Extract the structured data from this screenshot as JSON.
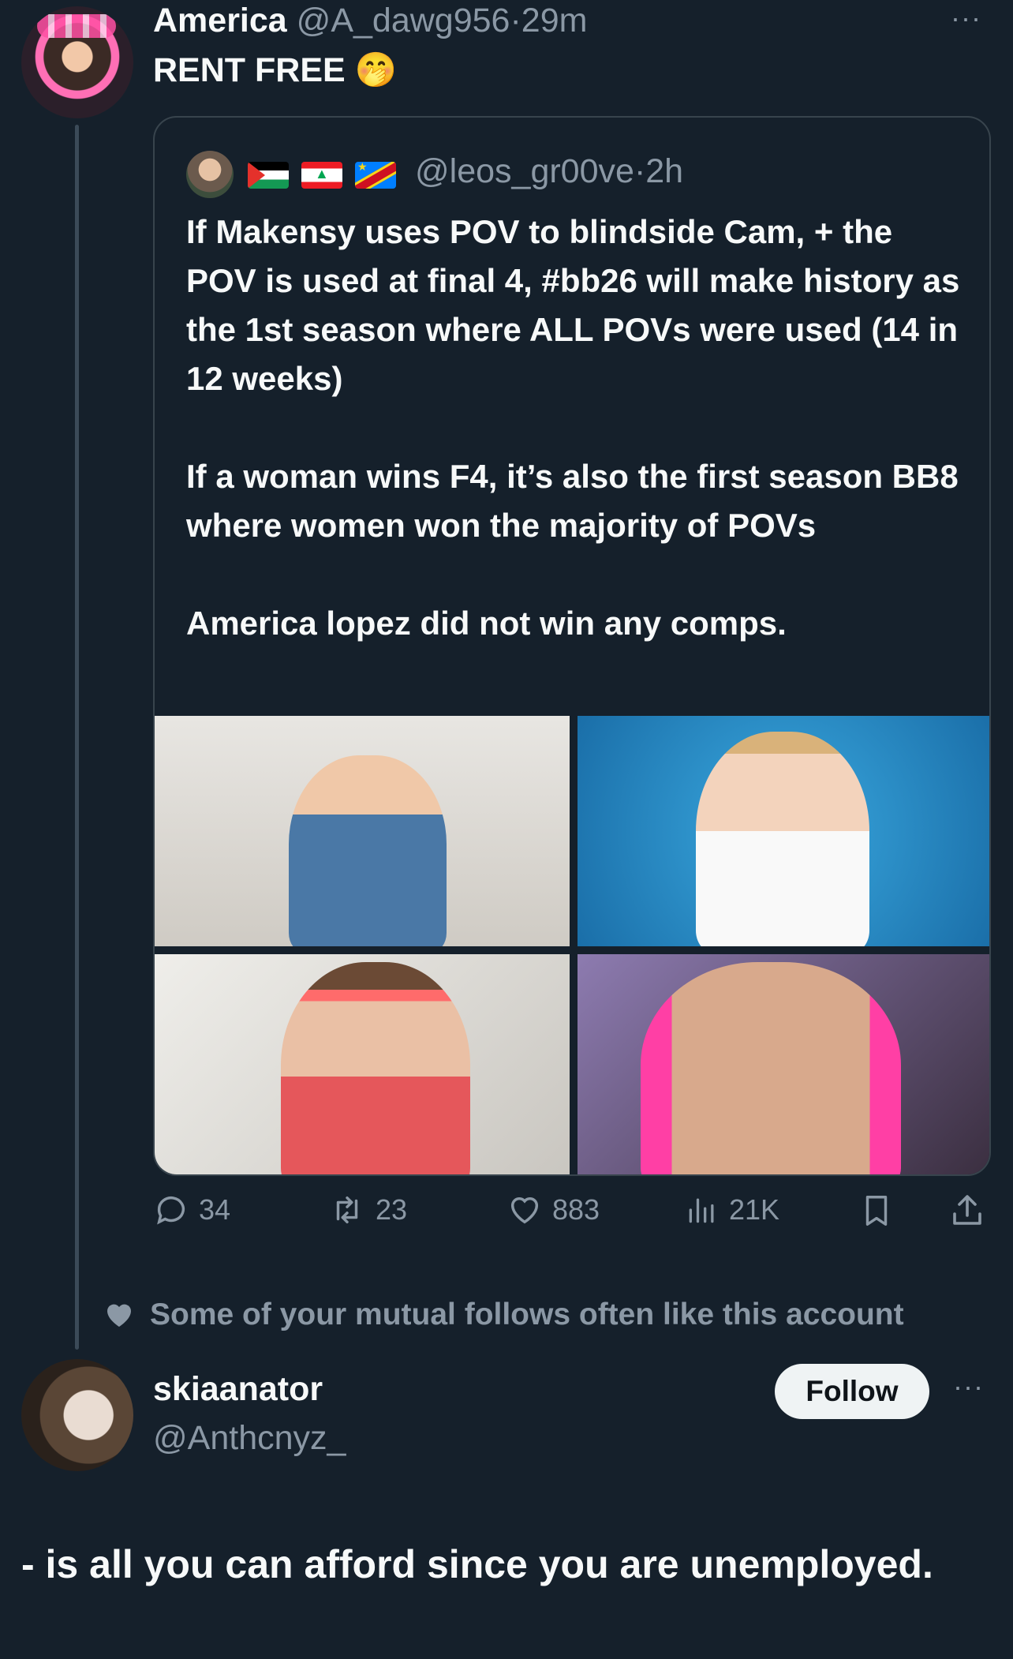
{
  "top_post": {
    "name": "America",
    "handle": "@A_dawg956",
    "dot": "·",
    "time": "29m",
    "text": "RENT FREE",
    "emoji": "🤭",
    "more": "···"
  },
  "quote": {
    "handle": "@leos_gr00ve",
    "dot": "·",
    "time": "2h",
    "flags": [
      "Palestine flag",
      "Lebanon flag",
      "DR Congo flag"
    ],
    "paragraph1": "If Makensy uses POV to blindside Cam, + the POV is used at final 4, #bb26 will make history as the 1st season where ALL POVs were used (14 in 12 weeks)",
    "paragraph2": "If a woman wins F4, it’s also the first season BB8 where women won the majority of POVs",
    "paragraph3": "America lopez did not win any comps."
  },
  "actions": {
    "replies": "34",
    "reposts": "23",
    "likes": "883",
    "views": "21K"
  },
  "social_proof": "Some of your mutual follows often like this account",
  "reply": {
    "name": "skiaanator",
    "handle": "@Anthcnyz_",
    "follow_label": "Follow",
    "more": "···",
    "text": "- is all you can afford since you are unemployed."
  },
  "colors": {
    "background": "#15202b",
    "muted": "#8b98a5",
    "text": "#f7f9f9",
    "border": "#38444d"
  },
  "icons": [
    "reply-icon",
    "repost-icon",
    "like-icon",
    "views-icon",
    "bookmark-icon",
    "share-icon",
    "heart-icon",
    "more-icon"
  ]
}
